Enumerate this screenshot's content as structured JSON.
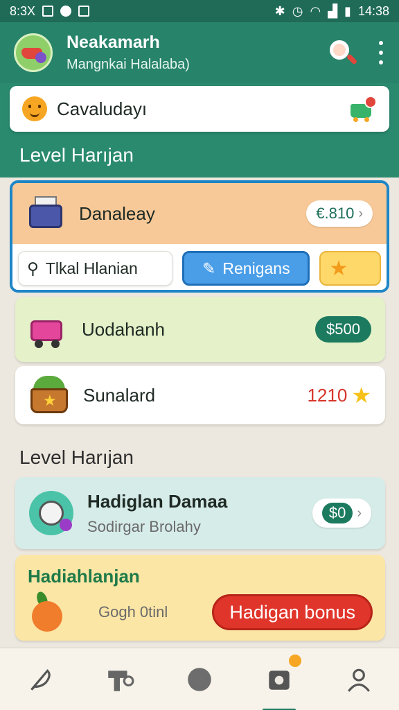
{
  "status_bar": {
    "left_text": "8:3X",
    "time": "14:38"
  },
  "app": {
    "title": "Neakamarh",
    "subtitle": "Mangnkai Halalaba)"
  },
  "header_card": {
    "text": "Cavaludayı"
  },
  "sections": [
    {
      "title": "Level Harıjan"
    },
    {
      "title": "Level Harıjan"
    }
  ],
  "focus_card": {
    "label": "Danaleay",
    "price": "€.810",
    "tabs": [
      {
        "label": "Tlkal Hlanian"
      },
      {
        "label": "Renigans"
      },
      {
        "label": ""
      }
    ]
  },
  "products": [
    {
      "label": "Uodahanh",
      "price": "$500"
    },
    {
      "label": "Sunalard",
      "score": "1210"
    }
  ],
  "promo_card": {
    "title": "Hadiglan Damaa",
    "subtitle": "Sodirgar Brolahy",
    "price": "$0"
  },
  "bonus_card": {
    "title": "Hadiahlanjan",
    "subtitle": "Gogh 0tinl",
    "button": "Hadigan bonus"
  },
  "colors": {
    "primary": "#27836a",
    "accent": "#e0352b",
    "highlight": "#1e86c7"
  },
  "bottom_nav": [
    {
      "icon": "feather-icon"
    },
    {
      "icon": "tools-icon"
    },
    {
      "icon": "compass-icon"
    },
    {
      "icon": "wallet-icon",
      "active": true
    },
    {
      "icon": "profile-icon"
    }
  ]
}
